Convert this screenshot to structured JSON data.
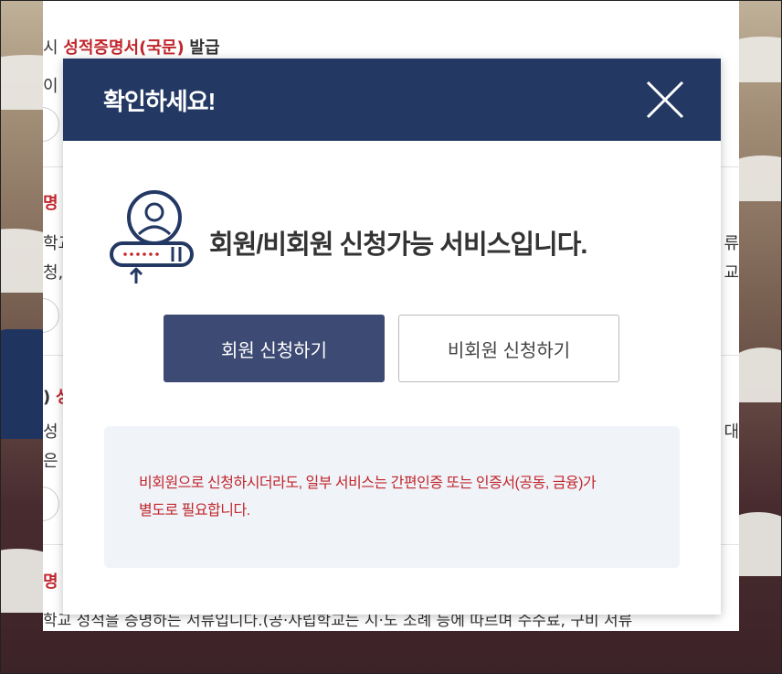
{
  "background_page": {
    "heading_1_prefix": "시",
    "heading_1_red": "성적증명서(국문)",
    "heading_1_suffix": "발급",
    "line_1": "이 용",
    "heading_2_red": "명",
    "line_2a": "학교",
    "line_2b": "청,",
    "right_2a": "류",
    "right_2b": "교",
    "heading_3_prefix": ")",
    "heading_3_red": "성",
    "line_3a": "성",
    "line_3b": "은",
    "right_3a": "대",
    "heading_4_red": "명",
    "line_4": "학교 성적을 증명하는 서류입니다.(공·사립학교는 시·도 조례 등에 따르며 수수료, 구비 서류"
  },
  "modal": {
    "title": "확인하세요!",
    "close_icon": "close-icon",
    "user_icon": "user-login-icon",
    "headline": "회원/비회원 신청가능 서비스입니다.",
    "member_button": "회원 신청하기",
    "guest_button": "비회원 신청하기",
    "notice_line_1": "비회원으로 신청하시더라도, 일부 서비스는 간편인증 또는 인증서(공동, 금융)가",
    "notice_line_2": "별도로 필요합니다."
  },
  "colors": {
    "header_bg": "#233863",
    "member_button_bg": "#3d4a73",
    "notice_bg": "#f0f3f8",
    "notice_text": "#c1272d",
    "accent_red": "#c1272d"
  }
}
